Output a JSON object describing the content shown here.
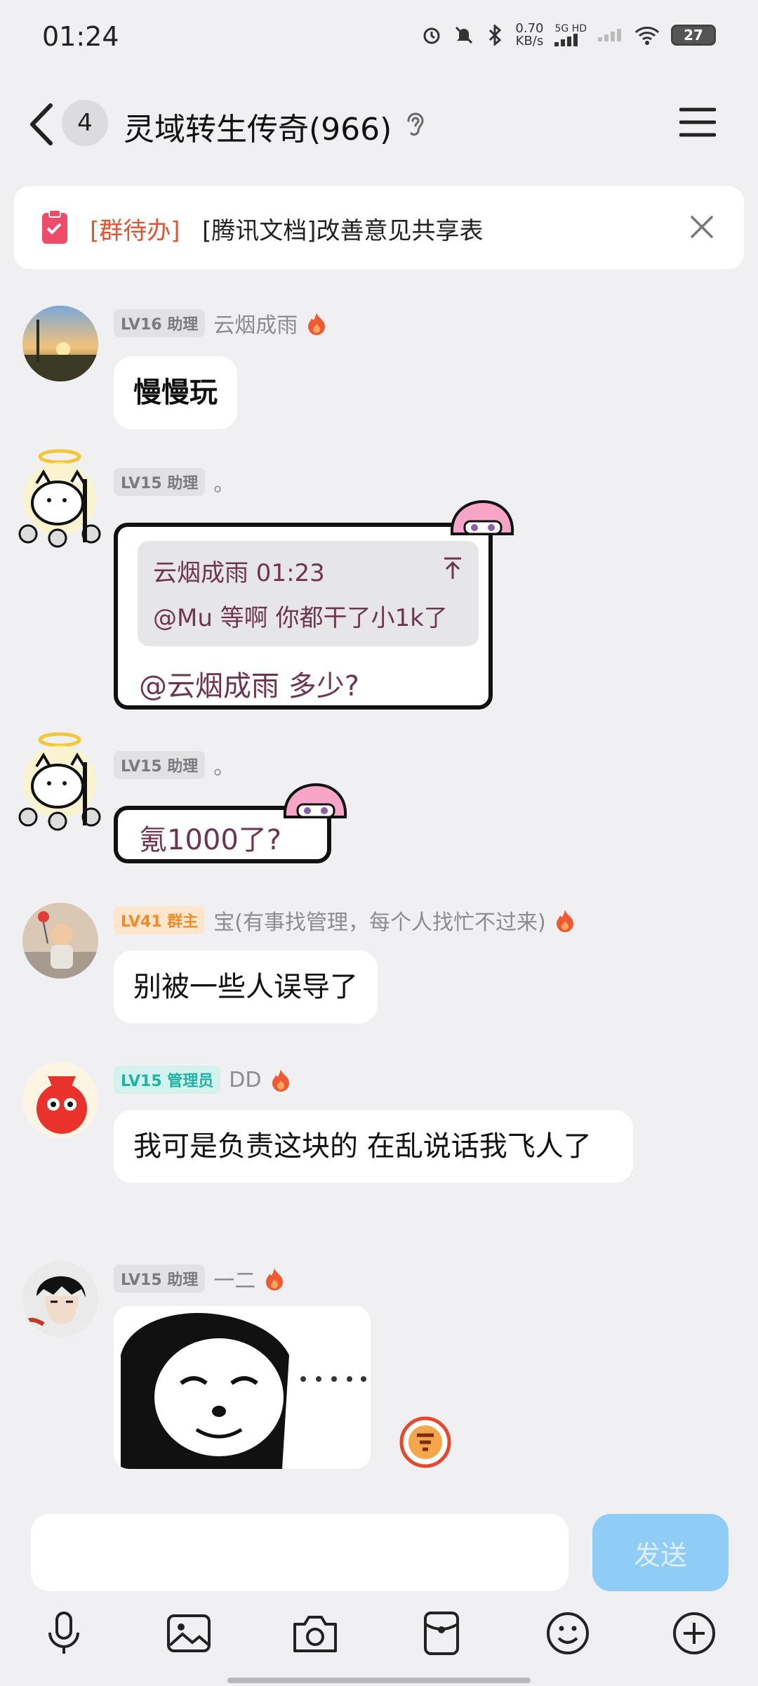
{
  "status": {
    "time": "01:24",
    "net_speed_value": "0.70",
    "net_speed_unit": "KB/s",
    "network": "5G HD",
    "battery": "27"
  },
  "header": {
    "unread": "4",
    "title": "灵域转生传奇(966)"
  },
  "banner": {
    "tag": "[群待办]",
    "text": "[腾讯文档]改善意见共享表"
  },
  "messages": [
    {
      "level": "LV16 助理",
      "sender": "云烟成雨",
      "text": "慢慢玩"
    },
    {
      "level": "LV15 助理",
      "sender": "。",
      "quote_header": "云烟成雨 01:23",
      "quote_text": "@Mu 等啊 你都干了小1k了",
      "text": "@云烟成雨 多少?"
    },
    {
      "level": "LV15 助理",
      "sender": "。",
      "text": "氪1000了?"
    },
    {
      "level": "LV41 群主",
      "sender": "宝(有事找管理，每个人找忙不过来)",
      "text": "别被一些人误导了"
    },
    {
      "level": "LV15 管理员",
      "sender": "DD",
      "text": "我可是负责这块的 在乱说话我飞人了"
    },
    {
      "level": "LV15 助理",
      "sender": "一二",
      "sticker": "panda-meme"
    }
  ],
  "input": {
    "send_label": "发送"
  },
  "toolbar": [
    "mic-icon",
    "image-icon",
    "camera-icon",
    "red-packet-icon",
    "emoji-icon",
    "plus-icon"
  ],
  "colors": {
    "accent_blue": "#8fcdf7",
    "todo_red": "#e4522f",
    "owner_orange": "#f08a2a",
    "admin_teal": "#1fb4a2"
  }
}
